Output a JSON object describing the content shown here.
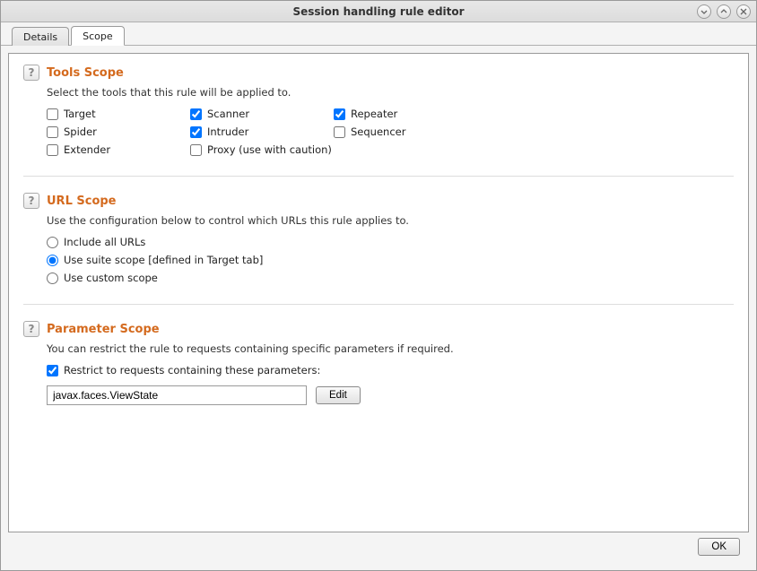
{
  "window": {
    "title": "Session handling rule editor"
  },
  "tabs": {
    "details": "Details",
    "scope": "Scope",
    "active": "scope"
  },
  "toolsScope": {
    "title": "Tools Scope",
    "desc": "Select the tools that this rule will be applied to.",
    "items": {
      "target": {
        "label": "Target",
        "checked": false
      },
      "scanner": {
        "label": "Scanner",
        "checked": true
      },
      "repeater": {
        "label": "Repeater",
        "checked": true
      },
      "spider": {
        "label": "Spider",
        "checked": false
      },
      "intruder": {
        "label": "Intruder",
        "checked": true
      },
      "sequencer": {
        "label": "Sequencer",
        "checked": false
      },
      "extender": {
        "label": "Extender",
        "checked": false
      },
      "proxy": {
        "label": "Proxy (use with caution)",
        "checked": false
      }
    }
  },
  "urlScope": {
    "title": "URL Scope",
    "desc": "Use the configuration below to control which URLs this rule applies to.",
    "options": {
      "all": {
        "label": "Include all URLs"
      },
      "suite": {
        "label": "Use suite scope [defined in Target tab]"
      },
      "custom": {
        "label": "Use custom scope"
      }
    },
    "selected": "suite"
  },
  "paramScope": {
    "title": "Parameter Scope",
    "desc": "You can restrict the rule to requests containing specific parameters if required.",
    "restrict": {
      "label": "Restrict to requests containing these parameters:",
      "checked": true
    },
    "value": "javax.faces.ViewState",
    "editLabel": "Edit"
  },
  "footer": {
    "ok": "OK"
  }
}
